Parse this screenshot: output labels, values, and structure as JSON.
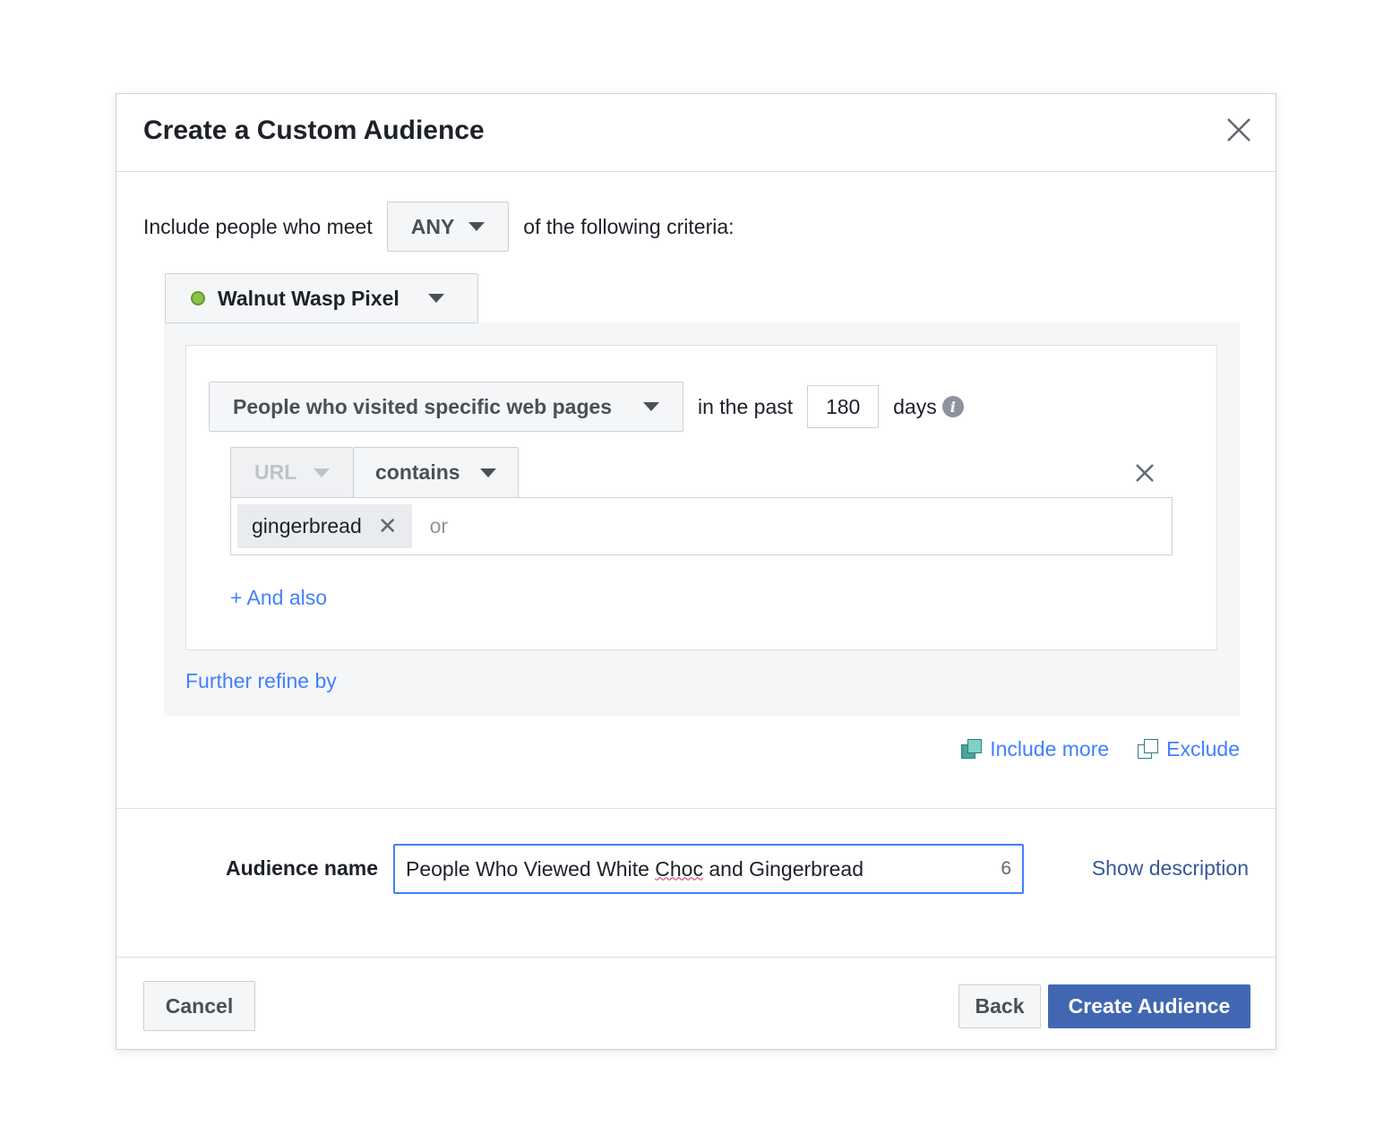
{
  "dialog": {
    "title": "Create a Custom Audience"
  },
  "criteria": {
    "prefix": "Include people who meet",
    "match_value": "ANY",
    "suffix": "of the following criteria:"
  },
  "pixel": {
    "name": "Walnut Wasp Pixel",
    "status_color": "#8cc04c"
  },
  "rule": {
    "visit_type": "People who visited specific web pages",
    "in_the_past": "in the past",
    "days_value": "180",
    "days_label": "days",
    "info_icon": "i",
    "field": "URL",
    "operator": "contains",
    "tags": [
      "gingerbread"
    ],
    "tag_remove": "✕",
    "or_placeholder": "or",
    "and_also": "+ And also"
  },
  "further_refine": "Further refine by",
  "include_more": "Include more",
  "exclude": "Exclude",
  "audience": {
    "label": "Audience name",
    "value_part1": "People Who Viewed White ",
    "value_squiggle": "Choc",
    "value_part2": " and Gingerbread",
    "count": "6",
    "show_description": "Show description"
  },
  "footer": {
    "cancel": "Cancel",
    "back": "Back",
    "create": "Create Audience"
  },
  "colors": {
    "primary": "#4267b2",
    "link": "#4080ff",
    "focus_border": "#4080ff"
  }
}
